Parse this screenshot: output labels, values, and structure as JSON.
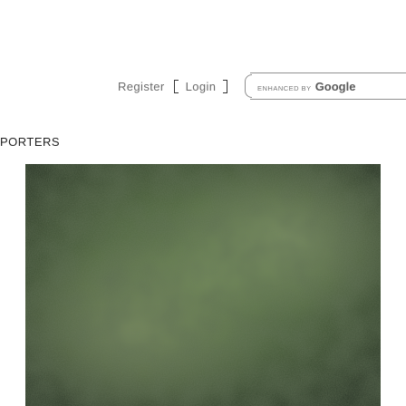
{
  "header": {
    "register_label": "Register",
    "login_label": "Login"
  },
  "search": {
    "enhanced_label": "ENHANCED BY",
    "provider_label": "Google"
  },
  "section": {
    "title": "PORTERS"
  },
  "hero": {
    "icon": "hero-photo"
  },
  "colors": {
    "text_gray": "#6a6a6a",
    "hero_dark": "#2d3a2b",
    "hero_moss": "#5f7a45"
  }
}
